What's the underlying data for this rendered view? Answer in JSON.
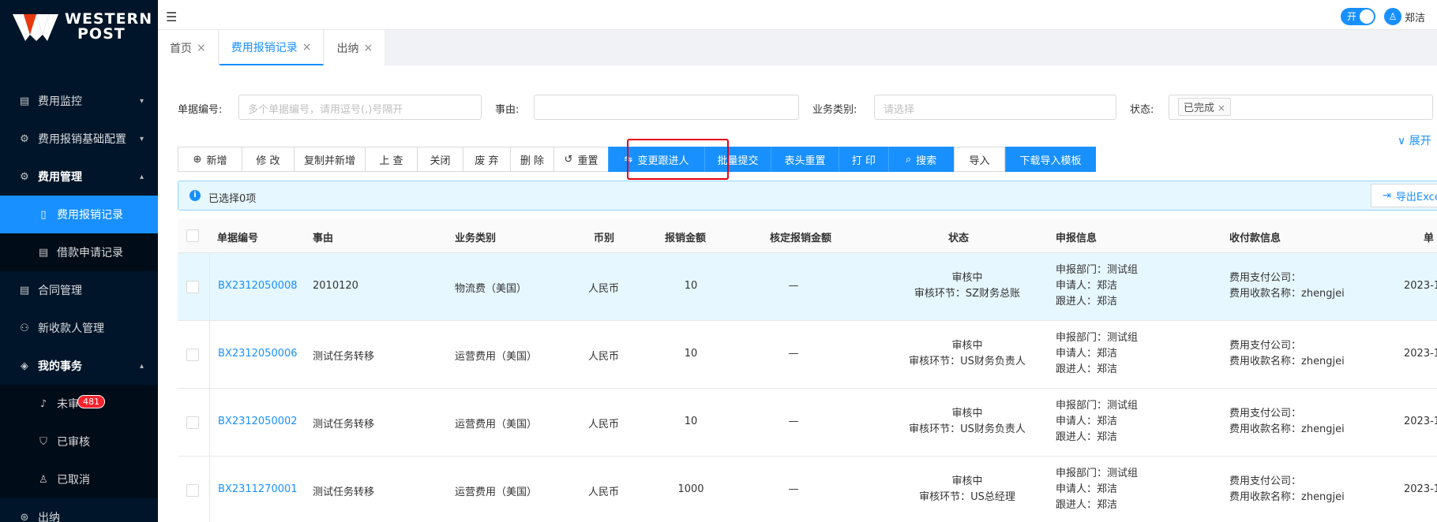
{
  "brand": {
    "line1": "WESTERN",
    "line2": "POST"
  },
  "sidebar": {
    "items": [
      {
        "label": "费用监控",
        "icon": "document-icon",
        "chev": "⌄"
      },
      {
        "label": "费用报销基础配置",
        "icon": "gear-icon",
        "chev": "⌄"
      },
      {
        "label": "费用管理",
        "icon": "gear-icon",
        "chev": "⌃"
      },
      {
        "label": "费用报销记录",
        "icon": "file-icon"
      },
      {
        "label": "借款申请记录",
        "icon": "list-icon"
      },
      {
        "label": "合同管理",
        "icon": "document-icon"
      },
      {
        "label": "新收款人管理",
        "icon": "people-icon"
      },
      {
        "label": "我的事务",
        "icon": "tag-icon",
        "chev": "⌃"
      },
      {
        "label": "未审",
        "icon": "bell-icon",
        "badge": "481"
      },
      {
        "label": "已审核",
        "icon": "shield-icon"
      },
      {
        "label": "已取消",
        "icon": "user-icon"
      },
      {
        "label": "出纳",
        "icon": "coin-icon"
      }
    ]
  },
  "topbar": {
    "toggle_label": "开",
    "username": "郑洁"
  },
  "tabs": [
    {
      "label": "首页"
    },
    {
      "label": "费用报销记录"
    },
    {
      "label": "出纳"
    }
  ],
  "filters": {
    "doc_no_label": "单据编号:",
    "doc_no_placeholder": "多个单据编号，请用逗号(,)号隔开",
    "reason_label": "事由:",
    "biz_label": "业务类别:",
    "biz_placeholder": "请选择",
    "status_label": "状态:",
    "status_tag": "已完成",
    "expand": "展开"
  },
  "toolbar": {
    "add": "新增",
    "edit": "修 改",
    "copy_add": "复制并新增",
    "lookup": "上 查",
    "close": "关闭",
    "discard": "废 弃",
    "delete": "删 除",
    "reset": "重置",
    "change_follower": "变更跟进人",
    "batch_submit": "批量提交",
    "header_reset": "表头重置",
    "print": "打 印",
    "search": "搜索",
    "import": "导入",
    "download_template": "下载导入模板"
  },
  "alert": {
    "text": "已选择0项",
    "export": "导出Excel"
  },
  "table": {
    "headers": [
      "单据编号",
      "事由",
      "业务类别",
      "币别",
      "报销金额",
      "核定报销金额",
      "状态",
      "申报信息",
      "收付款信息",
      "单"
    ],
    "rows": [
      {
        "doc_no": "BX2312050008",
        "reason": "2010120",
        "biz": "物流费（美国）",
        "currency": "人民币",
        "amount": "10",
        "approved": "—",
        "status1": "审核中",
        "status2": "审核环节：SZ财务总账",
        "dept": "申报部门：测试组",
        "applicant": "申请人：郑洁",
        "follower": "跟进人：郑洁",
        "pay_company": "费用支付公司：",
        "payee": "费用收款名称：zhengjei",
        "date": "2023-1"
      },
      {
        "doc_no": "BX2312050006",
        "reason": "测试任务转移",
        "biz": "运营费用（美国）",
        "currency": "人民币",
        "amount": "10",
        "approved": "—",
        "status1": "审核中",
        "status2": "审核环节：US财务负责人",
        "dept": "申报部门：测试组",
        "applicant": "申请人：郑洁",
        "follower": "跟进人：郑洁",
        "pay_company": "费用支付公司：",
        "payee": "费用收款名称：zhengjei",
        "date": "2023-1"
      },
      {
        "doc_no": "BX2312050002",
        "reason": "测试任务转移",
        "biz": "运营费用（美国）",
        "currency": "人民币",
        "amount": "10",
        "approved": "—",
        "status1": "审核中",
        "status2": "审核环节：US财务负责人",
        "dept": "申报部门：测试组",
        "applicant": "申请人：郑洁",
        "follower": "跟进人：郑洁",
        "pay_company": "费用支付公司：",
        "payee": "费用收款名称：zhengjei",
        "date": "2023-1"
      },
      {
        "doc_no": "BX2311270001",
        "reason": "测试任务转移",
        "biz": "运营费用（美国）",
        "currency": "人民币",
        "amount": "1000",
        "approved": "—",
        "status1": "审核中",
        "status2": "审核环节：US总经理",
        "dept": "申报部门：测试组",
        "applicant": "申请人：郑洁",
        "follower": "跟进人：郑洁",
        "pay_company": "费用支付公司：",
        "payee": "费用收款名称：zhengjei",
        "date": "2023-1"
      }
    ]
  },
  "colors": {
    "primary": "#1890ff",
    "sidebar_bg": "#001529",
    "highlight": "#e60012",
    "brand_red": "#e8380d"
  }
}
